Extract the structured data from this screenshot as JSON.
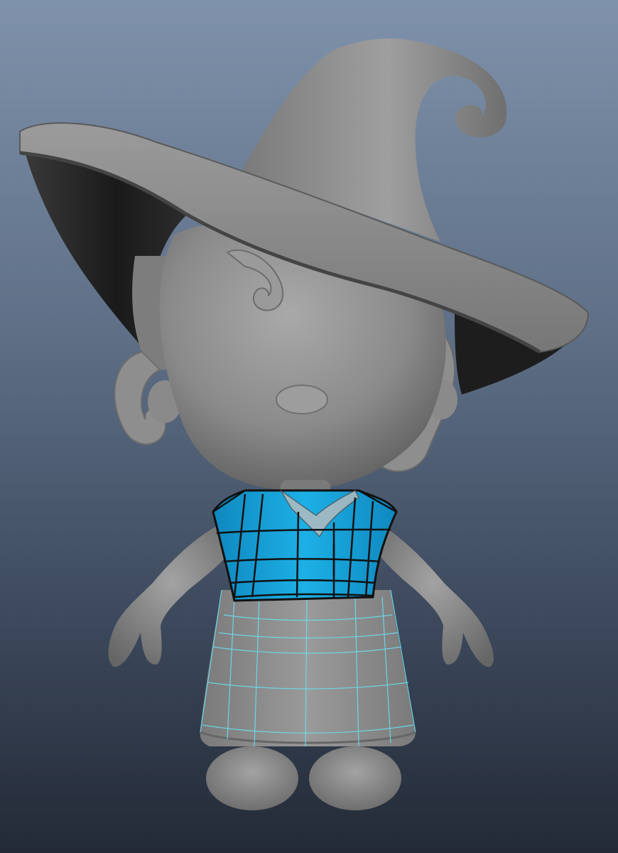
{
  "viewport": {
    "background_top": "#7f92ab",
    "background_bottom": "#232a36"
  },
  "model": {
    "body_color": "#8c8c8c",
    "shirt_color": "#1aa6dc",
    "wireframe_color": "#111111",
    "skirt_wire_color": "#67e3f5"
  }
}
